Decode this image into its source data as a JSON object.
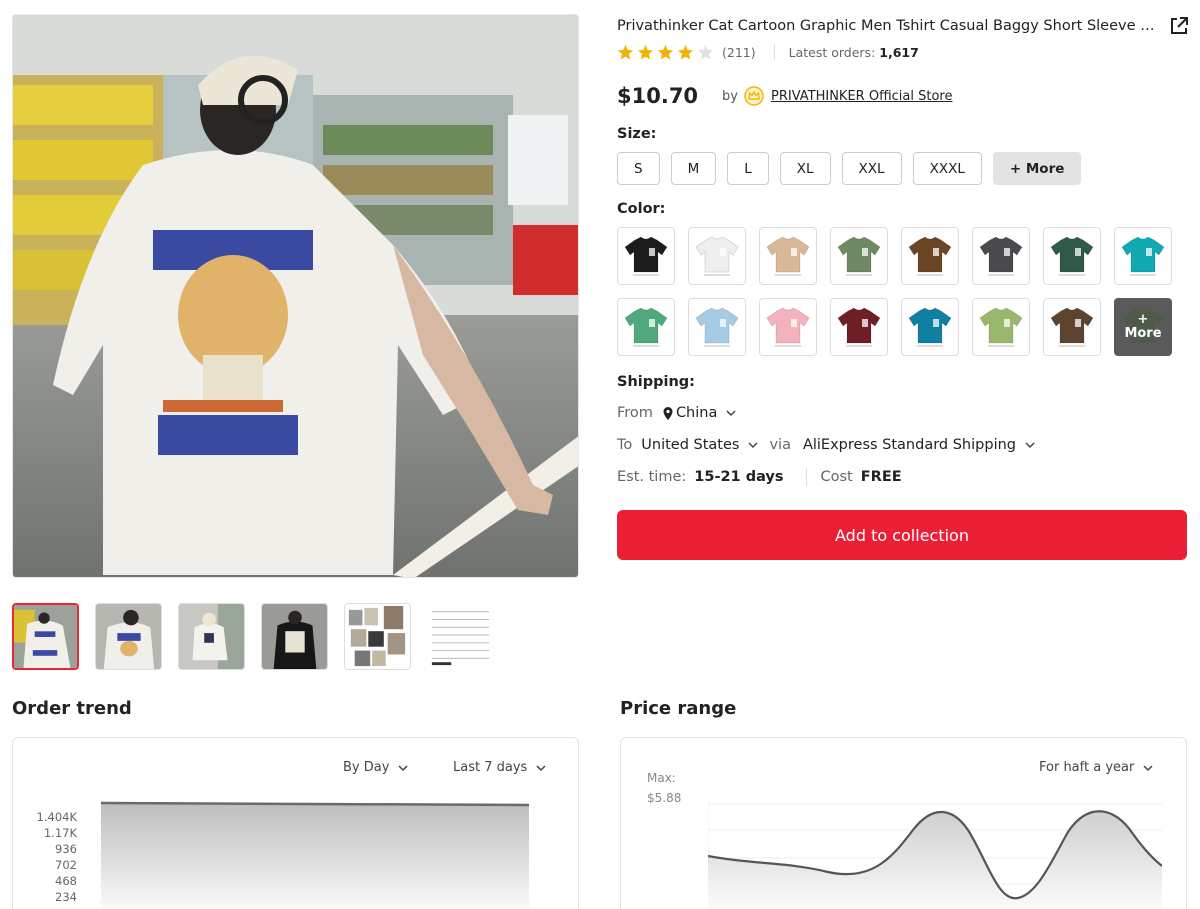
{
  "product": {
    "title": "Privathinker Cat Cartoon Graphic Men Tshirt Casual Baggy Short Sleeve T...",
    "rating_count": "(211)",
    "orders_label": "Latest orders:",
    "orders_value": "1,617",
    "price": "$10.70",
    "by_label": "by",
    "store": "PRIVATHINKER Official Store",
    "rating": 4
  },
  "size": {
    "label": "Size:",
    "options": [
      "S",
      "M",
      "L",
      "XL",
      "XXL",
      "XXXL"
    ],
    "more": "+ More"
  },
  "color": {
    "label": "Color:",
    "swatches": [
      "#1c1c1c",
      "#efefef",
      "#d8b896",
      "#6f8a63",
      "#6a4526",
      "#4a4a4e",
      "#2f5a48",
      "#12a8b4",
      "#4fa97c",
      "#a6cbe6",
      "#f2b3bd",
      "#6e1e24",
      "#0f7fa3",
      "#98b86b",
      "#5c4430"
    ],
    "more_plus": "+",
    "more_label": "More"
  },
  "shipping": {
    "label": "Shipping:",
    "from_label": "From",
    "from_value": "China",
    "to_label": "To",
    "to_value": "United States",
    "via_label": "via",
    "via_value": "AliExpress Standard Shipping",
    "time_label": "Est. time:",
    "time_value": "15-21 days",
    "cost_label": "Cost",
    "cost_value": "FREE"
  },
  "add_button": "Add to collection",
  "order_trend": {
    "title": "Order trend",
    "group_by": "By Day",
    "period": "Last 7 days",
    "yticks": [
      "1.404K",
      "1.17K",
      "936",
      "702",
      "468",
      "234"
    ]
  },
  "price_range": {
    "title": "Price range",
    "period": "For haft a year",
    "max_label": "Max:",
    "max_value": "$5.88"
  },
  "colors": {
    "accent": "#ea1f35",
    "star": "#f5b301",
    "thumb_active": "#e6283b"
  }
}
